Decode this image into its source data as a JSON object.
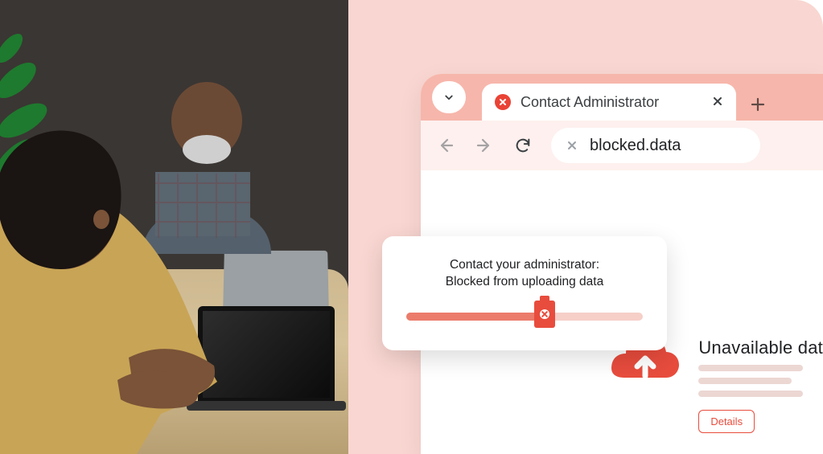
{
  "colors": {
    "accent": "#e84c3d",
    "tabbar": "#f7b6ab",
    "toolbar": "#fdf0ee",
    "bg_right": "#f9d6d1"
  },
  "browser": {
    "tab": {
      "title": "Contact Administrator"
    },
    "address": {
      "url": "blocked.data"
    }
  },
  "popup": {
    "line1": "Contact your administrator:",
    "line2": "Blocked from uploading data",
    "progress_percent": 58
  },
  "unavailable": {
    "title": "Unavailable dat",
    "details_label": "Details"
  }
}
